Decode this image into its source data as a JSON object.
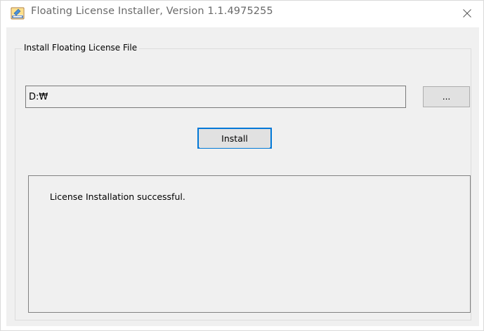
{
  "window": {
    "title": "Floating License Installer, Version 1.1.4975255",
    "icon": "license-installer-icon",
    "close_icon": "close-icon"
  },
  "group": {
    "title": "Install Floating License File"
  },
  "file_path": {
    "value": "D:₩"
  },
  "browse_button": {
    "label": "..."
  },
  "install_button": {
    "label": "Install"
  },
  "output": {
    "text": "License Installation successful."
  },
  "colors": {
    "client_background": "#f0f0f0",
    "button_face": "#e1e1e1",
    "focus_border": "#0078d7",
    "title_text": "#6a6a6a"
  }
}
